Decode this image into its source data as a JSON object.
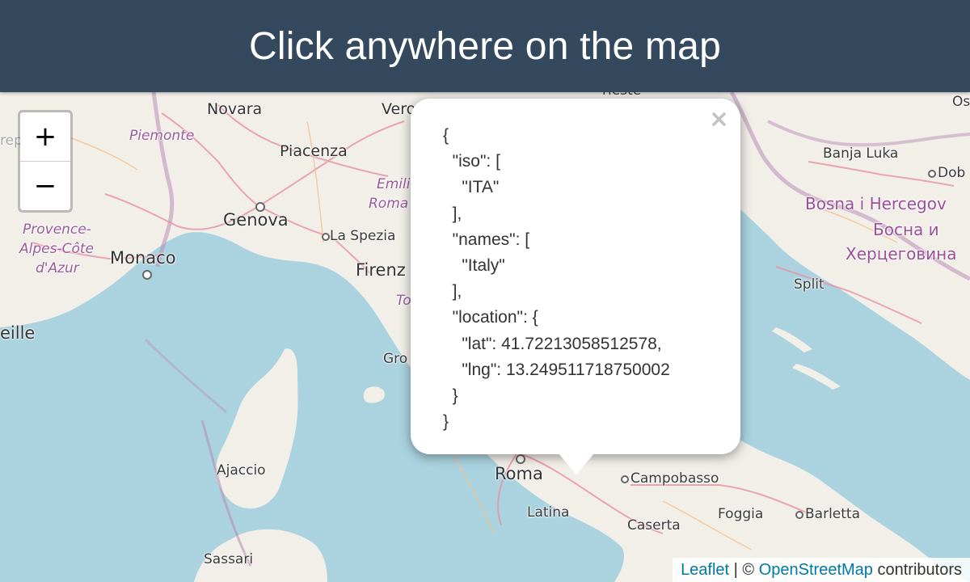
{
  "header": {
    "title": "Click anywhere on the map"
  },
  "zoom": {
    "in_label": "+",
    "out_label": "−"
  },
  "popup": {
    "close_label": "×",
    "iso": [
      "ITA"
    ],
    "names": [
      "Italy"
    ],
    "location": {
      "lat": 41.72213058512578,
      "lng": 13.249511718750002
    }
  },
  "places": [
    {
      "id": "novara",
      "text": "Novara"
    },
    {
      "id": "piemonte",
      "text": "Piemonte"
    },
    {
      "id": "piacenza",
      "text": "Piacenza"
    },
    {
      "id": "genova",
      "text": "Genova"
    },
    {
      "id": "la-spezia",
      "text": "La Spezia"
    },
    {
      "id": "provence",
      "text": "Provence-"
    },
    {
      "id": "alpes",
      "text": "Alpes-Côte"
    },
    {
      "id": "dazur",
      "text": "d'Azur"
    },
    {
      "id": "monaco",
      "text": "Monaco"
    },
    {
      "id": "marseille",
      "text": "eille"
    },
    {
      "id": "verona",
      "text": "Vero"
    },
    {
      "id": "emilia",
      "text": "Emili"
    },
    {
      "id": "romagna",
      "text": "Roma"
    },
    {
      "id": "firenze",
      "text": "Firenz"
    },
    {
      "id": "toscana",
      "text": "To"
    },
    {
      "id": "grosseto",
      "text": "Gro"
    },
    {
      "id": "trieste",
      "text": "rieste"
    },
    {
      "id": "banja-luka",
      "text": "Banja Luka"
    },
    {
      "id": "doboj",
      "text": "Dob"
    },
    {
      "id": "bosna",
      "text": "Bosna i Hercegov"
    },
    {
      "id": "bosna-cyr1",
      "text": "Босна и"
    },
    {
      "id": "bosna-cyr2",
      "text": "Херцеговина"
    },
    {
      "id": "split",
      "text": "Split"
    },
    {
      "id": "roma",
      "text": "Roma"
    },
    {
      "id": "latina",
      "text": "Latina"
    },
    {
      "id": "campobasso",
      "text": "Campobasso"
    },
    {
      "id": "foggia",
      "text": "Foggia"
    },
    {
      "id": "barletta",
      "text": "Barletta"
    },
    {
      "id": "caserta",
      "text": "Caserta"
    },
    {
      "id": "ajaccio",
      "text": "Ajaccio"
    },
    {
      "id": "sassari",
      "text": "Sassari"
    },
    {
      "id": "os",
      "text": "Os"
    },
    {
      "id": "rep",
      "text": "rep"
    }
  ],
  "attribution": {
    "leaflet": "Leaflet",
    "separator": " | © ",
    "osm": "OpenStreetMap",
    "suffix": " contributors"
  }
}
